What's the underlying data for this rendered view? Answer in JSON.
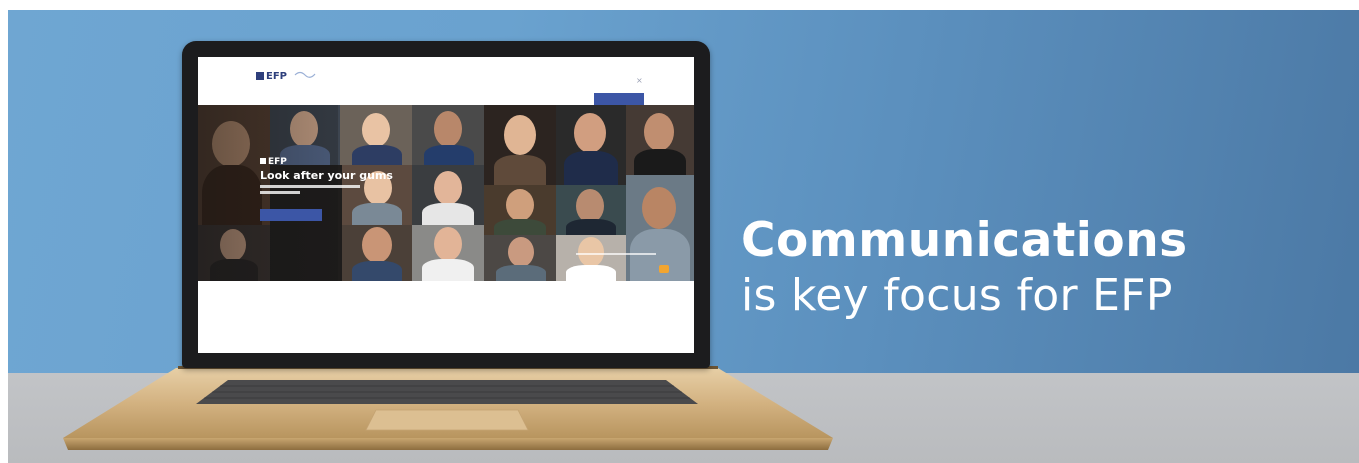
{
  "headline": {
    "line1": "Communications",
    "line2": "is key focus for EFP"
  },
  "site": {
    "logo_text": "EFP",
    "hero_title": "Look after your gums",
    "hero_logo_text": "EFP"
  },
  "colors": {
    "banner_blue": "#6aa2cf",
    "banner_dark_blue": "#4b78a4",
    "desk_grey": "#c2c4c7",
    "laptop_gold": "#d9b98a",
    "efp_navy": "#2e3f7c",
    "cta_blue": "#3c56a6",
    "badge_orange": "#f2a530"
  },
  "icons": {
    "efp_logo": "efp-logo-icon",
    "close": "close-icon"
  }
}
